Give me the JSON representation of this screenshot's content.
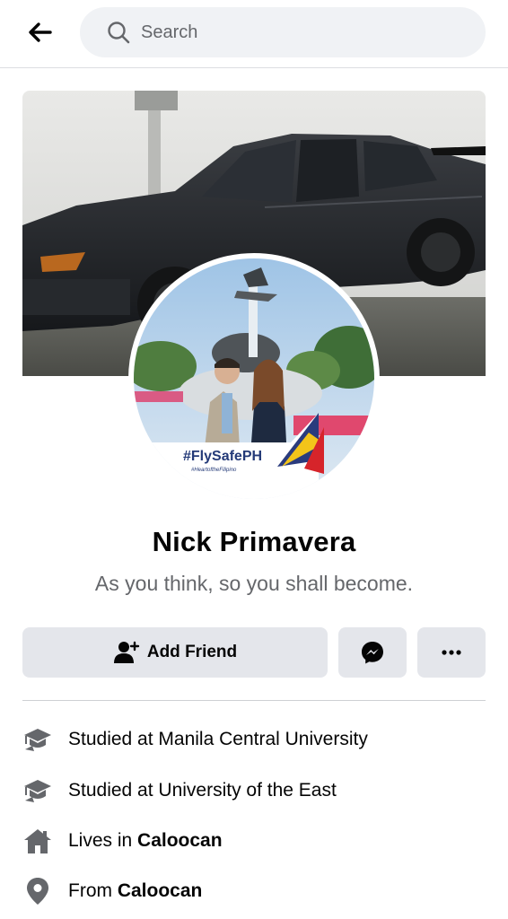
{
  "header": {
    "back_icon": "arrow-left-icon",
    "search_placeholder": "Search",
    "search_icon": "search-icon"
  },
  "profile": {
    "name": "Nick Primavera",
    "bio": "As you think, so you shall become.",
    "avatar_overlay": {
      "tag": "#FlySafePH",
      "subtag": "#HeartoftheFilipino"
    }
  },
  "actions": {
    "add_friend_label": "Add Friend",
    "add_friend_icon": "add-person-icon",
    "message_icon": "messenger-icon",
    "more_icon": "more-dots-icon"
  },
  "intro": [
    {
      "icon": "graduation-cap-icon",
      "prefix": "Studied at Manila Central University",
      "bold": ""
    },
    {
      "icon": "graduation-cap-icon",
      "prefix": "Studied at University of the East",
      "bold": ""
    },
    {
      "icon": "home-icon",
      "prefix": "Lives in ",
      "bold": "Caloocan"
    },
    {
      "icon": "location-pin-icon",
      "prefix": "From ",
      "bold": "Caloocan"
    }
  ],
  "colors": {
    "button_bg": "#e4e6eb",
    "search_bg": "#f0f2f5",
    "secondary_text": "#65676b",
    "icon_gray": "#65676b"
  }
}
